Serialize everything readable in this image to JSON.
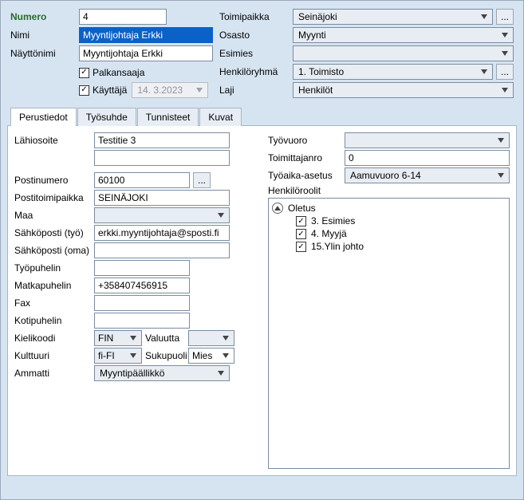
{
  "top": {
    "numero_label": "Numero",
    "numero_value": "4",
    "nimi_label": "Nimi",
    "nimi_value": "Myyntijohtaja Erkki",
    "nayttonimi_label": "Näyttönimi",
    "nayttonimi_value": "Myyntijohtaja Erkki",
    "palkansaaja_label": "Palkansaaja",
    "kayttaja_label": "Käyttäjä",
    "kayttaja_date": "14. 3.2023",
    "toimipaikka_label": "Toimipaikka",
    "toimipaikka_value": "Seinäjoki",
    "osasto_label": "Osasto",
    "osasto_value": "Myynti",
    "esimies_label": "Esimies",
    "esimies_value": "",
    "henkiloryhma_label": "Henkilöryhmä",
    "henkiloryhma_value": "1. Toimisto",
    "laji_label": "Laji",
    "laji_value": "Henkilöt"
  },
  "tabs": [
    "Perustiedot",
    "Työsuhde",
    "Tunnisteet",
    "Kuvat"
  ],
  "left": {
    "lahiosoite_label": "Lähiosoite",
    "lahiosoite_value": "Testitie 3",
    "postinumero_label": "Postinumero",
    "postinumero_value": "60100",
    "postitoimipaikka_label": "Postitoimipaikka",
    "postitoimipaikka_value": "SEINÄJOKI",
    "maa_label": "Maa",
    "maa_value": "",
    "sahkoposti_tyo_label": "Sähköposti (työ)",
    "sahkoposti_tyo_value": "erkki.myyntijohtaja@sposti.fi",
    "sahkoposti_oma_label": "Sähköposti (oma)",
    "sahkoposti_oma_value": "",
    "tyopuhelin_label": "Työpuhelin",
    "tyopuhelin_value": "",
    "matkapuhelin_label": "Matkapuhelin",
    "matkapuhelin_value": "+358407456915",
    "fax_label": "Fax",
    "fax_value": "",
    "kotipuhelin_label": "Kotipuhelin",
    "kotipuhelin_value": "",
    "kielikoodi_label": "Kielikoodi",
    "kielikoodi_value": "FIN",
    "valuutta_label": "Valuutta",
    "valuutta_value": "",
    "kulttuuri_label": "Kulttuuri",
    "kulttuuri_value": "fi-FI",
    "sukupuoli_label": "Sukupuoli",
    "sukupuoli_value": "Mies",
    "ammatti_label": "Ammatti",
    "ammatti_value": "Myyntipäällikkö"
  },
  "right": {
    "tyovuoro_label": "Työvuoro",
    "tyovuoro_value": "",
    "toimittajanro_label": "Toimittajanro",
    "toimittajanro_value": "0",
    "tyoaika_label": "Työaika-asetus",
    "tyoaika_value": "Aamuvuoro 6-14",
    "henkiloroolit_label": "Henkilöroolit",
    "tree_root": "Oletus",
    "tree_items": [
      {
        "label": " 3. Esimies"
      },
      {
        "label": " 4. Myyjä"
      },
      {
        "label": "15.Ylin johto"
      }
    ]
  }
}
